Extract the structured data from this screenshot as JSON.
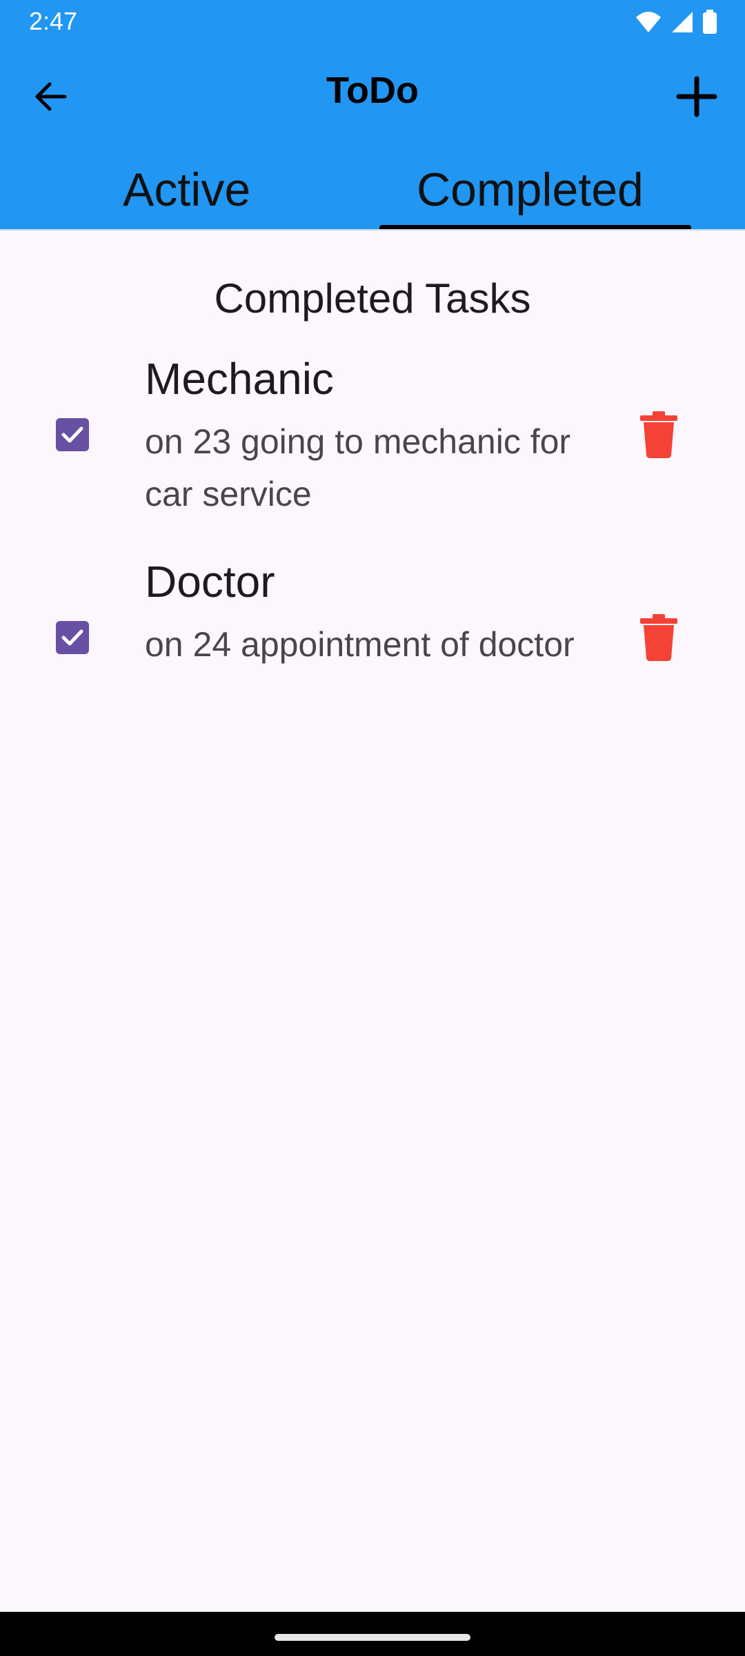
{
  "status_bar": {
    "time": "2:47",
    "icons": [
      "wifi-icon",
      "signal-icon",
      "battery-icon"
    ]
  },
  "app_bar": {
    "title": "ToDo",
    "back_icon": "arrow-back-icon",
    "add_icon": "plus-icon",
    "background_color": "#2196f3"
  },
  "tabs": [
    {
      "label": "Active",
      "selected": false
    },
    {
      "label": "Completed",
      "selected": true
    }
  ],
  "section": {
    "title": "Completed Tasks"
  },
  "tasks": [
    {
      "title": "Mechanic",
      "description": "on 23 going to mechanic for car service",
      "completed": true
    },
    {
      "title": "Doctor",
      "description": "on 24 appointment of doctor",
      "completed": true
    }
  ],
  "colors": {
    "checkbox": "#6750a4",
    "delete": "#f44336",
    "background": "#fcf6fd"
  }
}
